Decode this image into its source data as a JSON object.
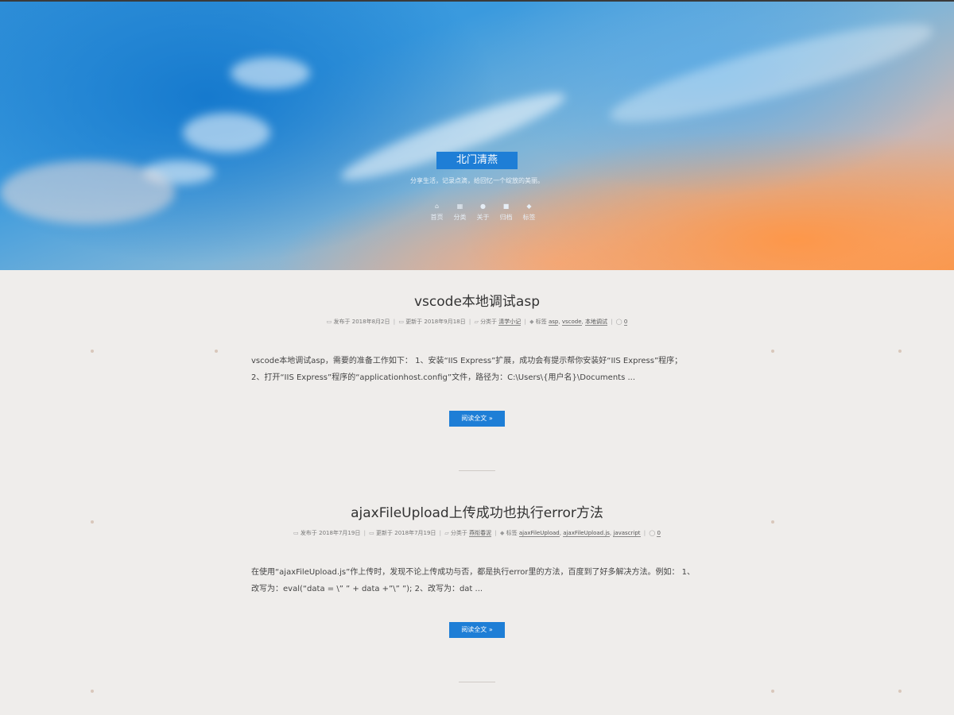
{
  "site": {
    "title": "北门清燕",
    "description": "分享生活，记录点滴，给回忆一个绽放的美丽。",
    "accent_color": "#1e7ed6"
  },
  "nav": [
    {
      "icon": "home-icon",
      "glyph": "⌂",
      "label": "首页"
    },
    {
      "icon": "grid-icon",
      "glyph": "▦",
      "label": "分类"
    },
    {
      "icon": "user-icon",
      "glyph": "●",
      "label": "关于"
    },
    {
      "icon": "archive-icon",
      "glyph": "■",
      "label": "归档"
    },
    {
      "icon": "tags-icon",
      "glyph": "◆",
      "label": "标签"
    }
  ],
  "posts": [
    {
      "title": "vscode本地调试asp",
      "published_label": "发布于",
      "published": "2018年8月2日",
      "updated_label": "更新于",
      "updated": "2018年9月18日",
      "category_label": "分类于",
      "category": "清学小记",
      "tags_label": "标签",
      "tags": [
        "asp",
        "vscode",
        "本地调试"
      ],
      "comments": "0",
      "excerpt_line1": "vscode本地调试asp，需要的准备工作如下： 1、安装“IIS Express”扩展，成功会有提示帮你安装好“IIS Express”程序；",
      "excerpt_line2": "2、打开“IIS Express”程序的“applicationhost.config”文件，路径为：C:\\Users\\{用户名}\\Documents ...",
      "read_more": "阅读全文 »"
    },
    {
      "title": "ajaxFileUpload上传成功也执行error方法",
      "published_label": "发布于",
      "published": "2018年7月19日",
      "updated_label": "更新于",
      "updated": "2018年7月19日",
      "category_label": "分类于",
      "category": "燕衔春泥",
      "tags_label": "标签",
      "tags": [
        "ajaxFileUpload",
        "ajaxFileUpload.js",
        "javascript"
      ],
      "comments": "0",
      "excerpt_line1": "在使用“ajaxFileUpload.js”作上传时，发现不论上传成功与否，都是执行error里的方法，百度到了好多解决方法。例如： 1、",
      "excerpt_line2": "改写为：eval(“data = \\”  ”  + data +”\\”  ”); 2、改写为：dat ...",
      "read_more": "阅读全文 »"
    }
  ]
}
